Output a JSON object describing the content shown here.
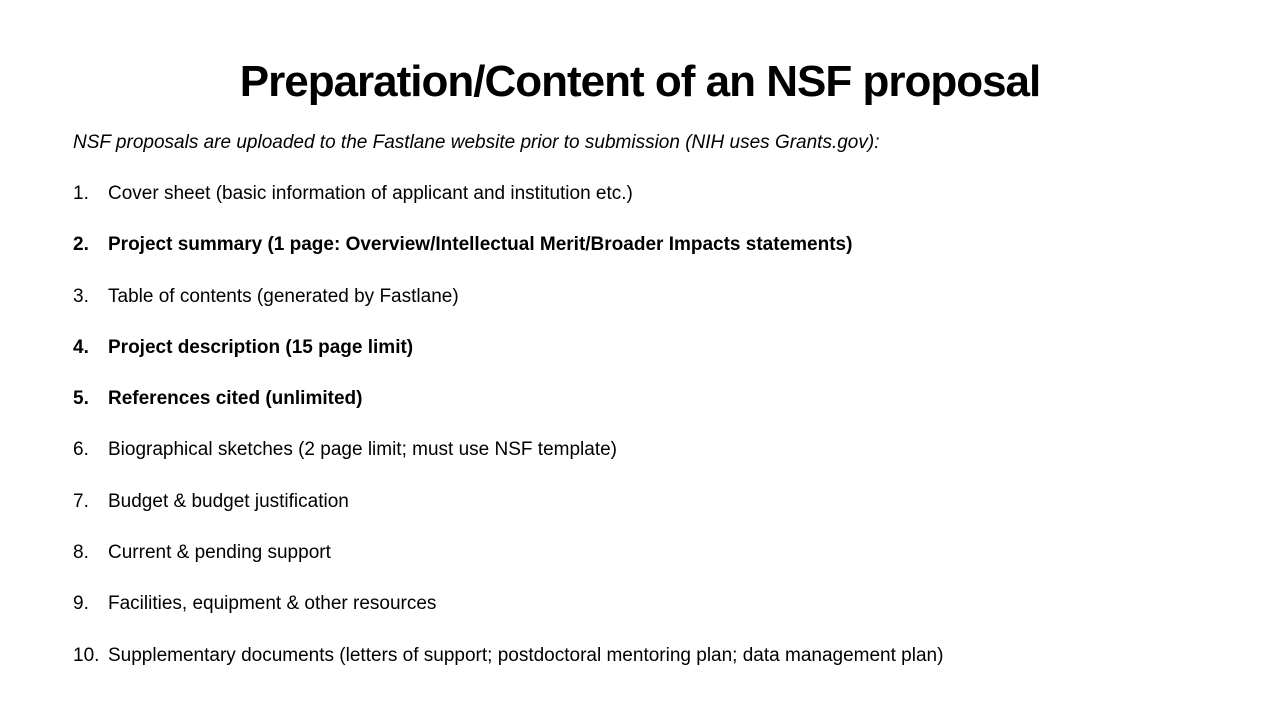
{
  "slide": {
    "title": "Preparation/Content of an NSF proposal",
    "intro": "NSF proposals are uploaded to the Fastlane website prior to submission (NIH uses Grants.gov):",
    "items": [
      {
        "number": "1.",
        "text": "Cover sheet (basic information of applicant and institution etc.)",
        "bold": false
      },
      {
        "number": "2.",
        "text": "Project summary (1 page: Overview/Intellectual Merit/Broader Impacts statements)",
        "bold": true
      },
      {
        "number": "3.",
        "text": "Table of contents (generated by Fastlane)",
        "bold": false
      },
      {
        "number": "4.",
        "text": "Project description (15 page limit)",
        "bold": true
      },
      {
        "number": "5.",
        "text": "References cited (unlimited)",
        "bold": true
      },
      {
        "number": "6.",
        "text": "Biographical sketches (2 page limit; must use NSF template)",
        "bold": false
      },
      {
        "number": "7.",
        "text": "Budget & budget justification",
        "bold": false
      },
      {
        "number": "8.",
        "text": "Current & pending support",
        "bold": false
      },
      {
        "number": "9.",
        "text": "Facilities, equipment & other resources",
        "bold": false
      },
      {
        "number": "10.",
        "text": "Supplementary documents (letters of support; postdoctoral mentoring plan; data management plan)",
        "bold": false
      }
    ]
  }
}
